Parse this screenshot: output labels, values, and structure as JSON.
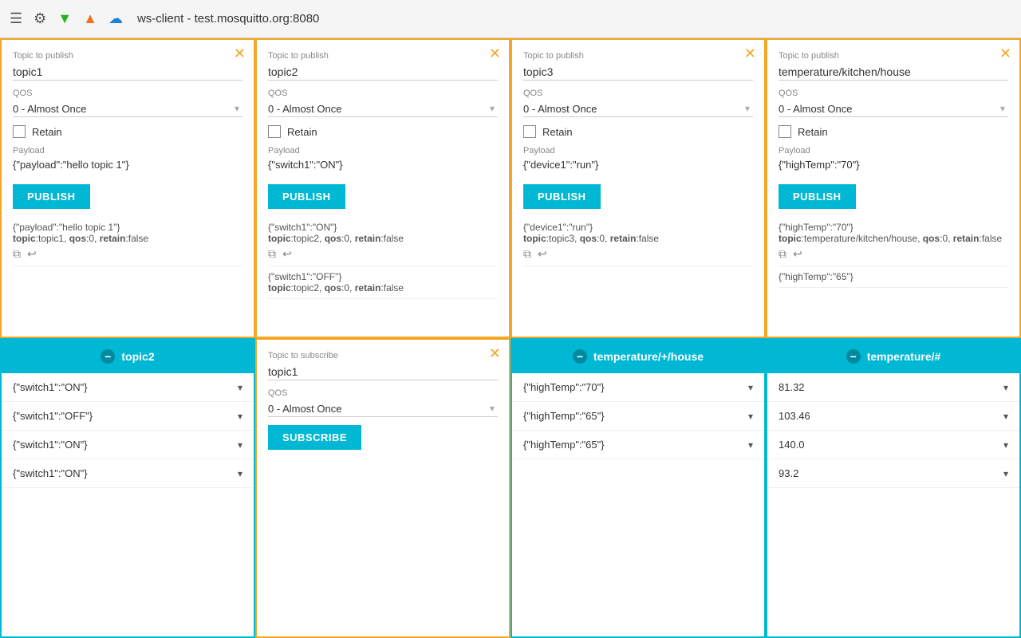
{
  "topbar": {
    "title": "ws-client - test.mosquitto.org:8080"
  },
  "publish_panels": [
    {
      "id": "pub1",
      "topic_label": "Topic to publish",
      "topic_value": "topic1",
      "qos_label": "QOS",
      "qos_value": "0 - Almost Once",
      "retain_label": "Retain",
      "payload_label": "Payload",
      "payload_value": "{\"payload\":\"hello topic 1\"}",
      "publish_btn": "PUBLISH",
      "history": [
        {
          "payload": "{\"payload\":\"hello topic 1\"}",
          "meta": "topic:topic1, qos:0, retain:false"
        }
      ]
    },
    {
      "id": "pub2",
      "topic_label": "Topic to publish",
      "topic_value": "topic2",
      "qos_label": "QOS",
      "qos_value": "0 - Almost Once",
      "retain_label": "Retain",
      "payload_label": "Payload",
      "payload_value": "{\"switch1\":\"ON\"}",
      "publish_btn": "PUBLISH",
      "history": [
        {
          "payload": "{\"switch1\":\"ON\"}",
          "meta": "topic:topic2, qos:0, retain:false"
        },
        {
          "payload": "{\"switch1\":\"OFF\"}",
          "meta": "topic:topic2, qos:0, retain:false"
        }
      ]
    },
    {
      "id": "pub3",
      "topic_label": "Topic to publish",
      "topic_value": "topic3",
      "qos_label": "QOS",
      "qos_value": "0 - Almost Once",
      "retain_label": "Retain",
      "payload_label": "Payload",
      "payload_value": "{\"device1\":\"run\"}",
      "publish_btn": "PUBLISH",
      "history": [
        {
          "payload": "{\"device1\":\"run\"}",
          "meta": "topic:topic3, qos:0, retain:false"
        }
      ]
    },
    {
      "id": "pub4",
      "topic_label": "Topic to publish",
      "topic_value": "temperature/kitchen/house",
      "qos_label": "QOS",
      "qos_value": "0 - Almost Once",
      "retain_label": "Retain",
      "payload_label": "Payload",
      "payload_value": "{\"highTemp\":\"70\"}",
      "publish_btn": "PUBLISH",
      "history": [
        {
          "payload": "{\"highTemp\":\"70\"}",
          "meta": "topic:temperature/kitchen/house, qos:0, retain:false"
        },
        {
          "payload": "{\"highTemp\":\"65\"}",
          "meta": ""
        }
      ]
    }
  ],
  "subscribe_panels": [
    {
      "id": "sub1",
      "type": "list",
      "header": "topic2",
      "items": [
        "{\"switch1\":\"ON\"}",
        "{\"switch1\":\"OFF\"}",
        "{\"switch1\":\"ON\"}",
        "{\"switch1\":\"ON\"}"
      ]
    },
    {
      "id": "sub2",
      "type": "form",
      "topic_label": "Topic to subscribe",
      "topic_value": "topic1",
      "qos_label": "QOS",
      "qos_value": "0 - Almost Once",
      "subscribe_btn": "SUBSCRIBE"
    },
    {
      "id": "sub3",
      "type": "list",
      "header": "temperature/+/house",
      "items": [
        "{\"highTemp\":\"70\"}",
        "{\"highTemp\":\"65\"}",
        "{\"highTemp\":\"65\"}"
      ]
    },
    {
      "id": "sub4",
      "type": "list",
      "header": "temperature/#",
      "items": [
        "81.32",
        "103.46",
        "140.0",
        "93.2"
      ]
    }
  ]
}
